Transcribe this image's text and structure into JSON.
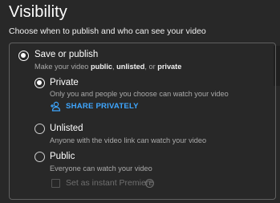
{
  "visibility": {
    "title": "Visibility",
    "subtitle": "Choose when to publish and who can see your video"
  },
  "save_or_publish": {
    "label": "Save or publish",
    "desc_prefix": "Make your video ",
    "desc_public": "public",
    "desc_sep1": ", ",
    "desc_unlisted": "unlisted",
    "desc_sep2": ", or ",
    "desc_private": "private",
    "selected": true
  },
  "options": {
    "private": {
      "label": "Private",
      "desc": "Only you and people you choose can watch your video",
      "selected": true,
      "share_label": "SHARE PRIVATELY"
    },
    "unlisted": {
      "label": "Unlisted",
      "desc": "Anyone with the video link can watch your video",
      "selected": false
    },
    "public": {
      "label": "Public",
      "desc": "Everyone can watch your video",
      "selected": false,
      "premiere_label": "Set as instant Premiere",
      "premiere_checked": false,
      "premiere_enabled": false
    }
  },
  "icons": {
    "share": "person-add-icon",
    "help": "help-circle-icon"
  },
  "colors": {
    "background": "#282828",
    "accent": "#3ea6ff",
    "secondary_text": "#aaaaaa",
    "disabled": "#6f6f6f"
  }
}
